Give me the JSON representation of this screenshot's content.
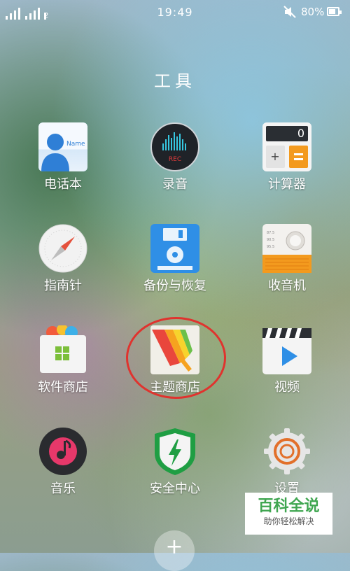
{
  "status_bar": {
    "sim_label": "2",
    "time": "19:49",
    "battery": "80%"
  },
  "folder": {
    "title": "工具"
  },
  "apps": [
    {
      "label": "电话本",
      "icon": "contacts-icon",
      "icon_text": "Name"
    },
    {
      "label": "录音",
      "icon": "recorder-icon",
      "icon_text": "REC"
    },
    {
      "label": "计算器",
      "icon": "calculator-icon",
      "icon_text": "0"
    },
    {
      "label": "指南针",
      "icon": "compass-icon"
    },
    {
      "label": "备份与恢复",
      "icon": "backup-icon"
    },
    {
      "label": "收音机",
      "icon": "radio-icon"
    },
    {
      "label": "软件商店",
      "icon": "app-store-icon"
    },
    {
      "label": "主题商店",
      "icon": "theme-store-icon"
    },
    {
      "label": "视频",
      "icon": "video-icon"
    },
    {
      "label": "音乐",
      "icon": "music-icon"
    },
    {
      "label": "安全中心",
      "icon": "security-center-icon"
    },
    {
      "label": "设置",
      "icon": "settings-icon"
    }
  ],
  "watermark": {
    "title": "百科全说",
    "subtitle": "助你轻松解决"
  },
  "colors": {
    "highlight": "#e0332e",
    "watermark_green": "#3fa650",
    "calculator_orange": "#f39a1e",
    "security_green": "#1f9e43"
  }
}
